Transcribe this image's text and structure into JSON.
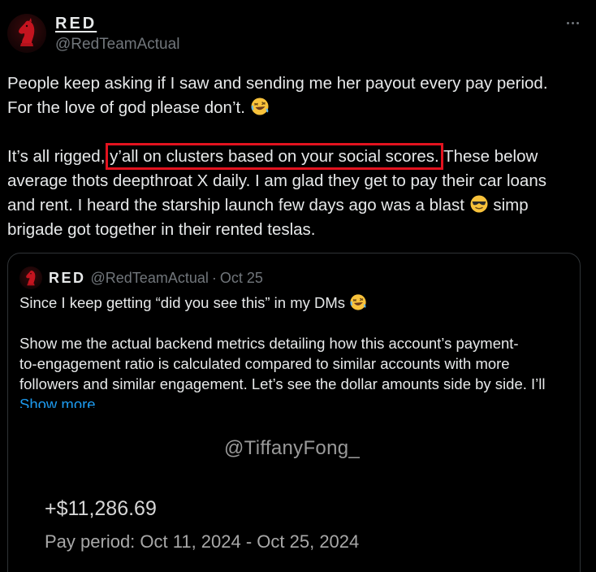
{
  "author": {
    "name": "RED",
    "handle": "@RedTeamActual"
  },
  "post": {
    "p1_l1": "People keep asking if I saw and sending me her payout every pay period.",
    "p1_l2": "For the love of god please don’t.",
    "p2_l1_pre": "It’s all rigged, ",
    "p2_l1_highlight": "y’all on clusters based on your social scores.",
    "p2_l1_post": " These below",
    "p2_l2": "average thots deepthroat X daily. I am glad they get to pay their car loans",
    "p2_l3": "and rent. I heard the starship launch few days ago was a blast",
    "p2_l3_post": " simp",
    "p2_l4": "brigade got together in their rented teslas."
  },
  "emojis": {
    "laughing": "rolling-on-floor-laughing-emoji",
    "sunglasses": "smiling-face-with-sunglasses-emoji"
  },
  "highlight_color": "#e3131f",
  "quote": {
    "name": "RED",
    "handle": "@RedTeamActual",
    "separator": "·",
    "date": "Oct 25",
    "l1": "Since I keep getting “did you see this” in my DMs",
    "l2": "Show me the actual backend metrics detailing how this account’s payment-",
    "l3": "to-engagement ratio is calculated compared to similar accounts with more",
    "l4": "followers and similar engagement. Let’s see the dollar amounts side by side. I’ll",
    "show_more": "Show more",
    "media": {
      "watermark": "@TiffanyFong_",
      "amount": "+$11,286.69",
      "pay_period": "Pay period: Oct 11, 2024 - Oct 25, 2024"
    }
  }
}
